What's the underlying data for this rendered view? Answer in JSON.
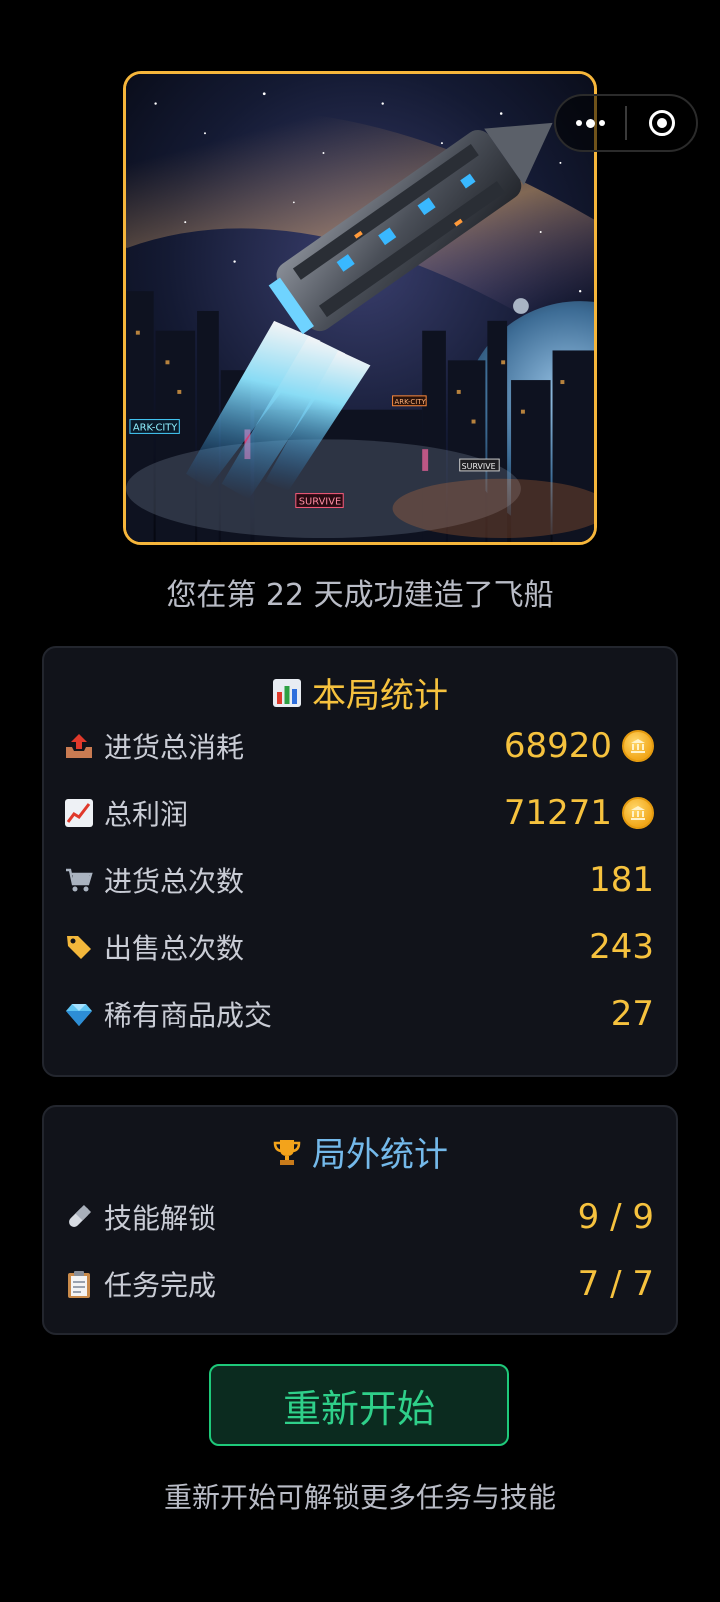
{
  "hero": {
    "signs": [
      "ARK-CITY",
      "SURVIVE",
      "ARK-CITY",
      "SURVIVE"
    ]
  },
  "subtitle": "您在第 22 天成功建造了飞船",
  "game_stats": {
    "title": "本局统计",
    "rows": [
      {
        "icon": "outbox-tray-icon",
        "label": "进货总消耗",
        "value": "68920"
      },
      {
        "icon": "chart-increasing-icon",
        "label": "总利润",
        "value": "71271"
      },
      {
        "icon": "shopping-cart-icon",
        "label": "进货总次数",
        "value": "181"
      },
      {
        "icon": "price-tag-icon",
        "label": "出售总次数",
        "value": "243"
      },
      {
        "icon": "gem-icon",
        "label": "稀有商品成交",
        "value": "27"
      }
    ]
  },
  "meta_stats": {
    "title": "局外统计",
    "rows": [
      {
        "icon": "pill-icon",
        "label": "技能解锁",
        "value": "9 / 9"
      },
      {
        "icon": "clipboard-icon",
        "label": "任务完成",
        "value": "7 / 7"
      }
    ]
  },
  "restart_label": "重新开始",
  "hint": "重新开始可解锁更多任务与技能",
  "colors": {
    "accent_gold": "#f6c23e",
    "accent_blue": "#74b9ea",
    "accent_green": "#2fd08a",
    "frame": "#f6b63b"
  }
}
